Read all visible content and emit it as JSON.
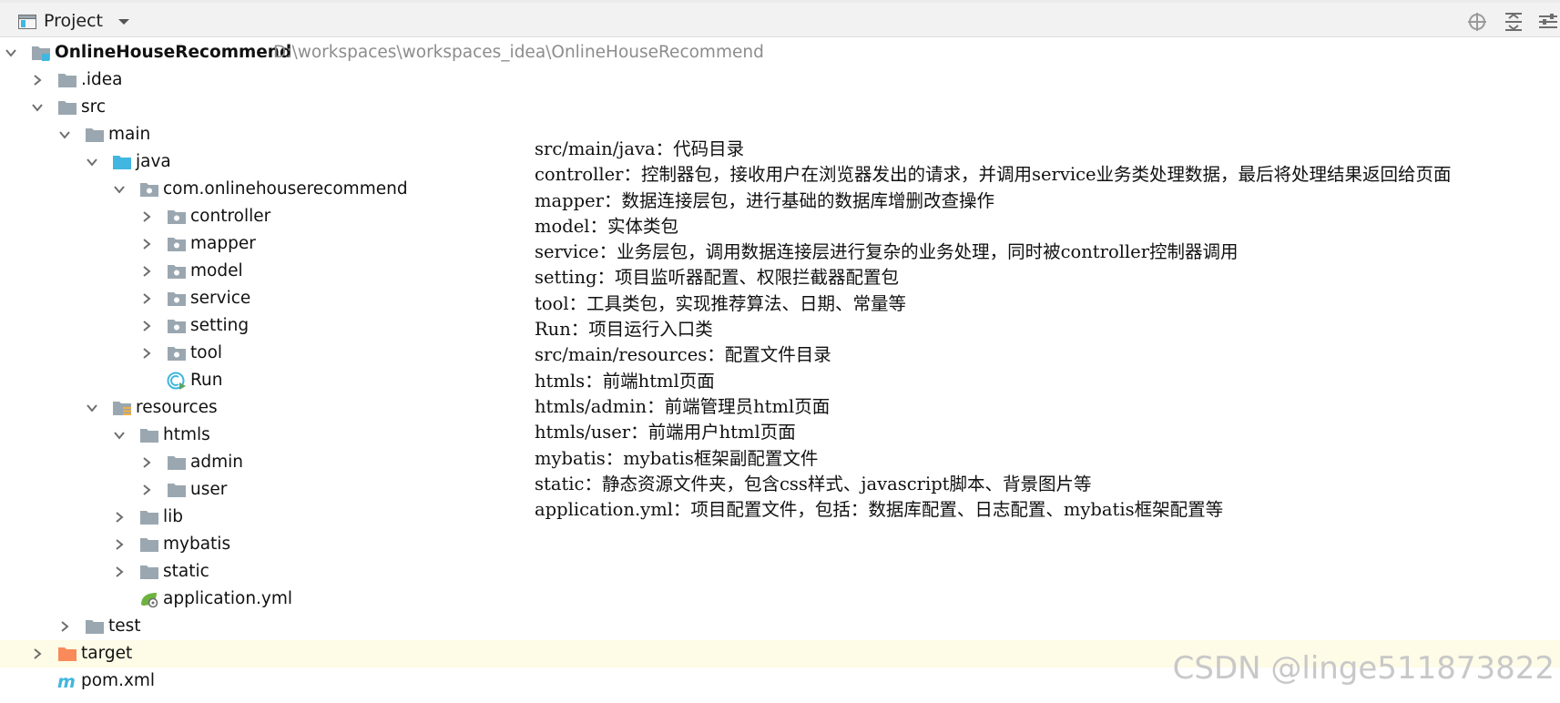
{
  "header": {
    "title": "Project",
    "icons": [
      "project-view-icon",
      "dropdown-icon",
      "locate-icon",
      "collapse-all-icon",
      "settings-icon"
    ]
  },
  "tree": {
    "root": {
      "label": "OnlineHouseRecommend",
      "path": "D:\\workspaces\\workspaces_idea\\OnlineHouseRecommend"
    },
    "items": {
      "idea": ".idea",
      "src": "src",
      "main": "main",
      "java": "java",
      "package": "com.onlinehouserecommend",
      "controller": "controller",
      "mapper": "mapper",
      "model": "model",
      "service": "service",
      "setting": "setting",
      "tool": "tool",
      "run": "Run",
      "resources": "resources",
      "htmls": "htmls",
      "admin": "admin",
      "user": "user",
      "lib": "lib",
      "mybatis": "mybatis",
      "static": "static",
      "application_yml": "application.yml",
      "test": "test",
      "target": "target",
      "pom": "pom.xml"
    }
  },
  "notes": [
    "src/main/java：代码目录",
    "controller：控制器包，接收用户在浏览器发出的请求，并调用service业务类处理数据，最后将处理结果返回给页面",
    "mapper：数据连接层包，进行基础的数据库增删改查操作",
    "model：实体类包",
    "service：业务层包，调用数据连接层进行复杂的业务处理，同时被controller控制器调用",
    "setting：项目监听器配置、权限拦截器配置包",
    "tool：工具类包，实现推荐算法、日期、常量等",
    "Run：项目运行入口类",
    "src/main/resources：配置文件目录",
    "htmls：前端html页面",
    "htmls/admin：前端管理员html页面",
    "htmls/user：前端用户html页面",
    "mybatis：mybatis框架副配置文件",
    "static：静态资源文件夹，包含css样式、javascript脚本、背景图片等",
    "application.yml：项目配置文件，包括：数据库配置、日志配置、mybatis框架配置等"
  ],
  "watermark": "CSDN @linge511873822",
  "colors": {
    "header_bg": "#f2f2f2",
    "highlight_row": "#fefbe6",
    "folder_gray": "#9aa7b0",
    "source_folder_blue": "#40b6e0",
    "resources_folder_gold": "#f4af3d",
    "excluded_folder_orange": "#f98b5b",
    "path_gray": "#8c8c8c"
  }
}
